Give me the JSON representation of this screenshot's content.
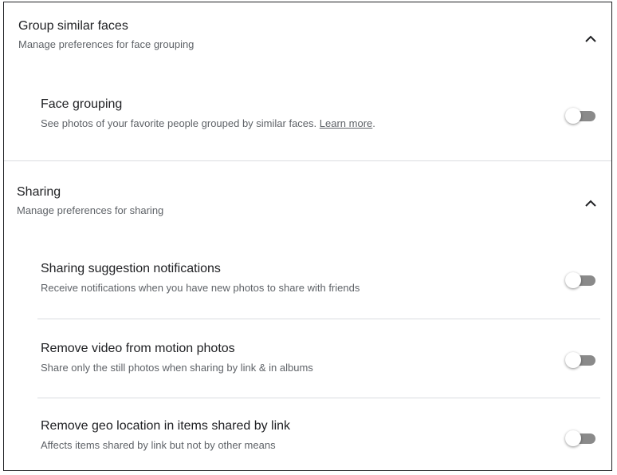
{
  "sections": [
    {
      "title": "Group similar faces",
      "subtitle": "Manage preferences for face grouping",
      "settings": [
        {
          "title": "Face grouping",
          "description": "See photos of your favorite people grouped by similar faces.",
          "link": "Learn more",
          "link_suffix": ".",
          "enabled": false
        }
      ]
    },
    {
      "title": "Sharing",
      "subtitle": "Manage preferences for sharing",
      "settings": [
        {
          "title": "Sharing suggestion notifications",
          "description": "Receive notifications when you have new photos to share with friends",
          "enabled": false
        },
        {
          "title": "Remove video from motion photos",
          "description": "Share only the still photos when sharing by link & in albums",
          "enabled": false
        },
        {
          "title": "Remove geo location in items shared by link",
          "description": "Affects items shared by link but not by other means",
          "enabled": false
        }
      ]
    }
  ],
  "icons": {
    "collapse": "chevron-up-icon"
  },
  "colors": {
    "toggle_track_off": "#8a8a8a",
    "divider": "#dadce0"
  }
}
